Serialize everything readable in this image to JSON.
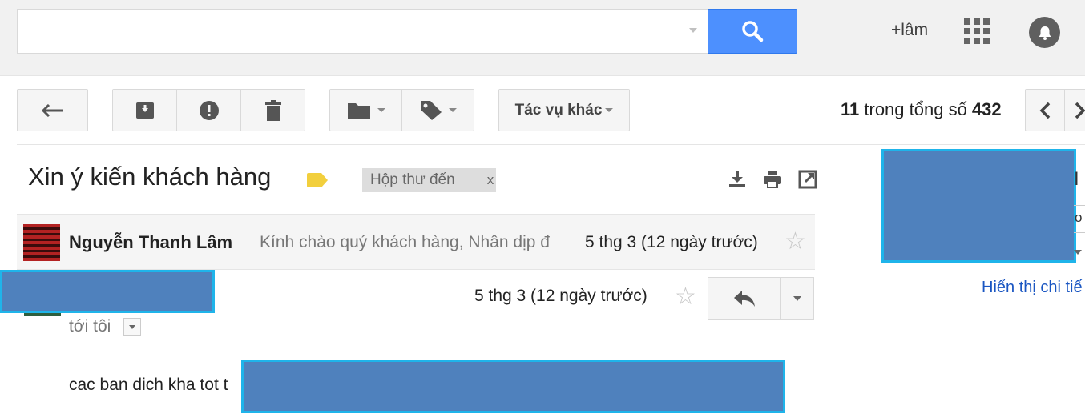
{
  "search": {
    "value": "",
    "placeholder": ""
  },
  "header": {
    "user_label": "+lâm"
  },
  "toolbar": {
    "more_actions_label": "Tác vụ khác",
    "pager": {
      "current": "11",
      "middle_text": " trong tổng số ",
      "total": "432"
    }
  },
  "thread": {
    "subject": "Xin ý kiến khách hàng",
    "inbox_label": "Hộp thư đến",
    "inbox_label_close": "x"
  },
  "messages": [
    {
      "sender": "Nguyễn Thanh Lâm",
      "snippet": "Kính chào quý khách hàng, Nhân dịp đ",
      "date": "5 thg 3 (12 ngày trước)",
      "star": "☆"
    },
    {
      "date": "5 thg 3 (12 ngày trước)",
      "star": "☆",
      "recipient_text": "tới tôi",
      "body": "cac ban dich kha tot t"
    }
  ],
  "right_panel": {
    "show_details_link": "Hiển thị chi tiế",
    "fragment_1": "I",
    "fragment_2": "o"
  },
  "colors": {
    "accent_blue": "#4d90fe",
    "redaction_fill": "#4f81bd",
    "redaction_border": "#1fb4ea",
    "tag_yellow": "#f2cf3d"
  }
}
